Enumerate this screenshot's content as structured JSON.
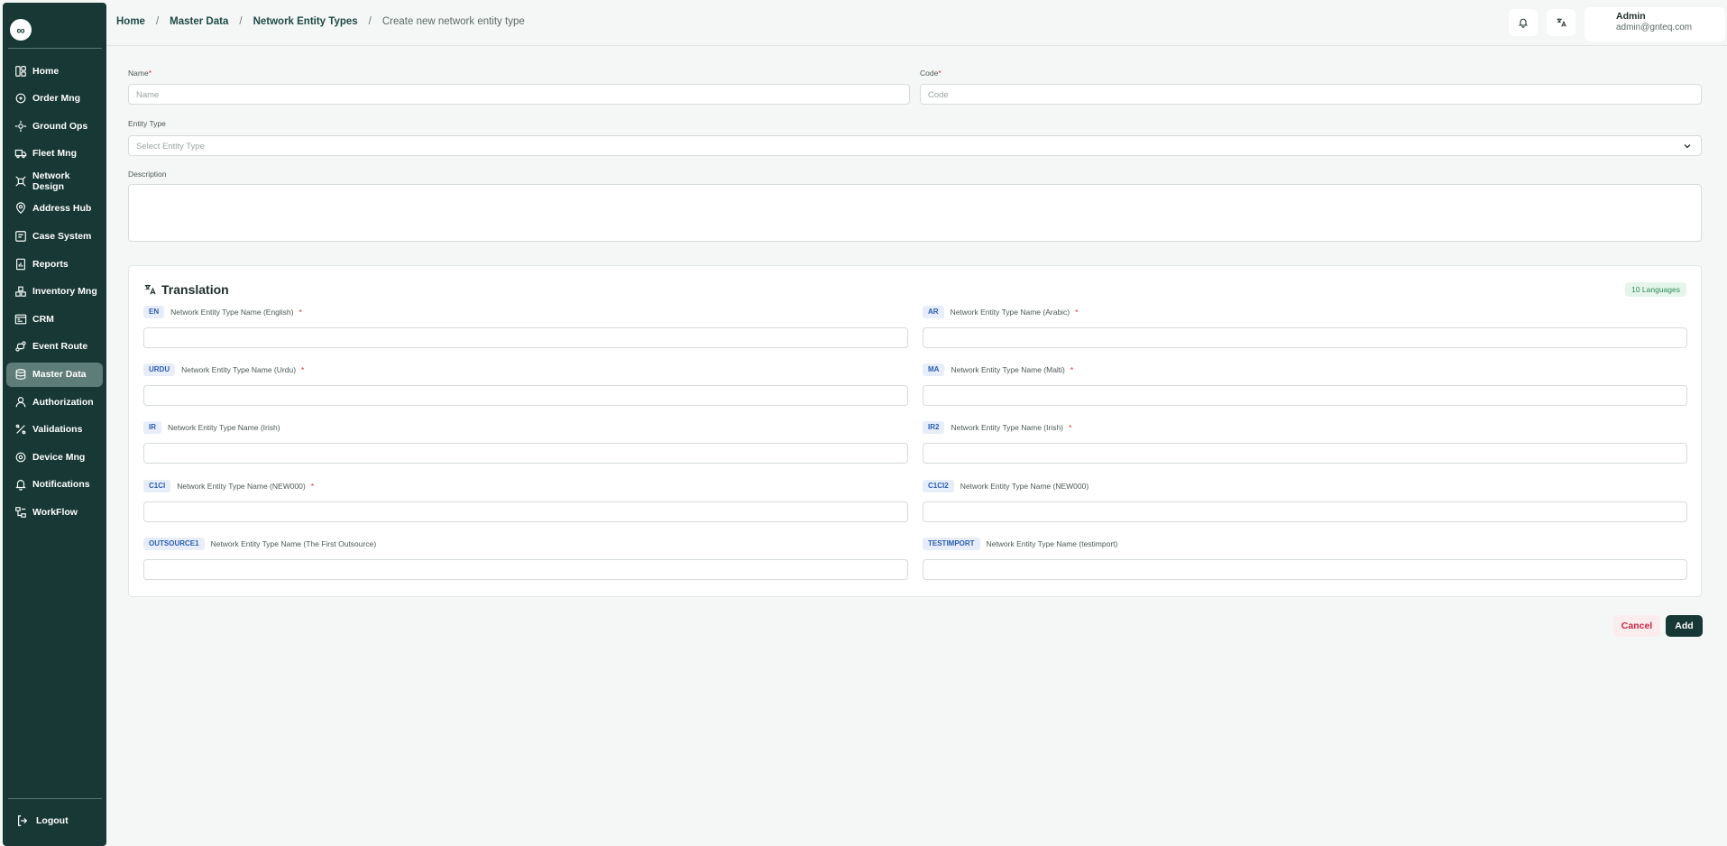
{
  "sidebar": {
    "logo": "∞",
    "items": [
      {
        "label": "Home",
        "icon": "dashboard-icon"
      },
      {
        "label": "Order Mng",
        "icon": "orders-icon"
      },
      {
        "label": "Ground Ops",
        "icon": "ground-ops-icon"
      },
      {
        "label": "Fleet Mng",
        "icon": "truck-icon"
      },
      {
        "label": "Network Design",
        "icon": "network-icon"
      },
      {
        "label": "Address Hub",
        "icon": "location-icon"
      },
      {
        "label": "Case System",
        "icon": "case-icon"
      },
      {
        "label": "Reports",
        "icon": "report-icon"
      },
      {
        "label": "Inventory Mng",
        "icon": "inventory-icon"
      },
      {
        "label": "CRM",
        "icon": "crm-icon"
      },
      {
        "label": "Event Route",
        "icon": "route-icon"
      },
      {
        "label": "Master Data",
        "icon": "database-icon",
        "active": true
      },
      {
        "label": "Authorization",
        "icon": "user-icon"
      },
      {
        "label": "Validations",
        "icon": "validation-icon"
      },
      {
        "label": "Device Mng",
        "icon": "device-icon"
      },
      {
        "label": "Notifications",
        "icon": "bell-icon"
      },
      {
        "label": "WorkFlow",
        "icon": "workflow-icon"
      }
    ],
    "logout": "Logout"
  },
  "header": {
    "breadcrumbs": [
      "Home",
      "Master Data",
      "Network Entity Types",
      "Create new network entity type"
    ],
    "user_name": "Admin",
    "user_email": "admin@gnteq.com"
  },
  "form": {
    "name_label": "Name",
    "name_placeholder": "Name",
    "code_label": "Code",
    "code_placeholder": "Code",
    "entity_type_label": "Entity Type",
    "entity_type_placeholder": "Select Entity Type",
    "description_label": "Description",
    "required_mark": "*"
  },
  "translation": {
    "title": "Translation",
    "languages_badge": "10 Languages",
    "fields": [
      {
        "code": "EN",
        "label": "Network Entity Type Name (English)",
        "required": true
      },
      {
        "code": "AR",
        "label": "Network Entity Type Name (Arabic)",
        "required": true
      },
      {
        "code": "URDU",
        "label": "Network Entity Type Name (Urdu)",
        "required": true
      },
      {
        "code": "MA",
        "label": "Network Entity Type Name (Malti)",
        "required": true
      },
      {
        "code": "IR",
        "label": "Network Entity Type Name (Irish)",
        "required": false
      },
      {
        "code": "IR2",
        "label": "Network Entity Type Name (Irish)",
        "required": true
      },
      {
        "code": "C1CI",
        "label": "Network Entity Type Name (NEW000)",
        "required": true
      },
      {
        "code": "C1CI2",
        "label": "Network Entity Type Name (NEW000)",
        "required": false
      },
      {
        "code": "OUTSOURCE1",
        "label": "Network Entity Type Name (The First Outsource)",
        "required": false
      },
      {
        "code": "TESTIMPORT",
        "label": "Network Entity Type Name (testimport)",
        "required": false
      }
    ]
  },
  "actions": {
    "cancel": "Cancel",
    "add": "Add"
  }
}
